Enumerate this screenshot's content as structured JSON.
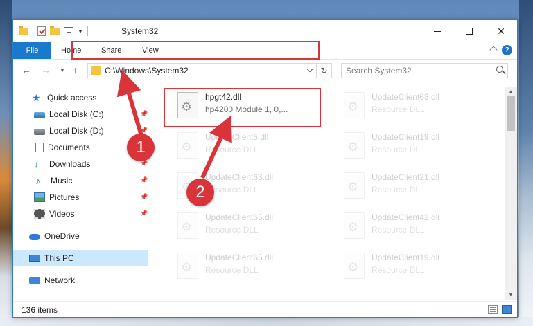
{
  "window": {
    "title": "System32",
    "min_glyph": "",
    "max_glyph": "",
    "close_glyph": "✕"
  },
  "ribbon": {
    "tabs": [
      "File",
      "Home",
      "Share",
      "View"
    ],
    "help_glyph": "?"
  },
  "nav": {
    "back_glyph": "←",
    "forward_glyph": "→",
    "recent_glyph": "▼",
    "up_glyph": "↑",
    "address": "C:\\Windows\\System32",
    "refresh_glyph": "↻",
    "search_placeholder": "Search System32"
  },
  "sidebar": {
    "items": [
      {
        "label": "Quick access",
        "icon": "star-icon",
        "pinned": false
      },
      {
        "label": "Local Disk (C:)",
        "icon": "drive-icon",
        "pinned": true
      },
      {
        "label": "Local Disk (D:)",
        "icon": "drive-icon",
        "pinned": true
      },
      {
        "label": "Documents",
        "icon": "documents-icon",
        "pinned": true
      },
      {
        "label": "Downloads",
        "icon": "downloads-icon",
        "pinned": true
      },
      {
        "label": "Music",
        "icon": "music-icon",
        "pinned": true
      },
      {
        "label": "Pictures",
        "icon": "pictures-icon",
        "pinned": true
      },
      {
        "label": "Videos",
        "icon": "videos-icon",
        "pinned": true
      },
      {
        "label": "OneDrive",
        "icon": "onedrive-icon",
        "pinned": false
      },
      {
        "label": "This PC",
        "icon": "this-pc-icon",
        "pinned": false,
        "selected": true
      },
      {
        "label": "Network",
        "icon": "network-icon",
        "pinned": false
      }
    ],
    "pin_glyph": "📌"
  },
  "files": [
    {
      "name": "hpgt42.dll",
      "desc": "hp4200 Module 1, 0,...",
      "highlight": true
    },
    {
      "name": "UpdateClient63.dll",
      "desc": "Resource DLL"
    },
    {
      "name": "UpdateClient5.dll",
      "desc": "Resource DLL"
    },
    {
      "name": "UpdateClient19.dll",
      "desc": "Resource DLL"
    },
    {
      "name": "UpdateClient63.dll",
      "desc": "Resource DLL"
    },
    {
      "name": "UpdateClient21.dll",
      "desc": "Resource DLL"
    },
    {
      "name": "UpdateClient65.dll",
      "desc": "Resource DLL"
    },
    {
      "name": "UpdateClient42.dll",
      "desc": "Resource DLL"
    },
    {
      "name": "UpdateClient65.dll",
      "desc": "Resource DLL"
    },
    {
      "name": "UpdateClient19.dll",
      "desc": "Resource DLL"
    }
  ],
  "status": {
    "items_count": "136 items"
  },
  "annotations": {
    "step1": "1",
    "step2": "2",
    "accent_color": "#d9343a"
  },
  "scroll": {
    "up_glyph": "▲",
    "down_glyph": "▼"
  }
}
